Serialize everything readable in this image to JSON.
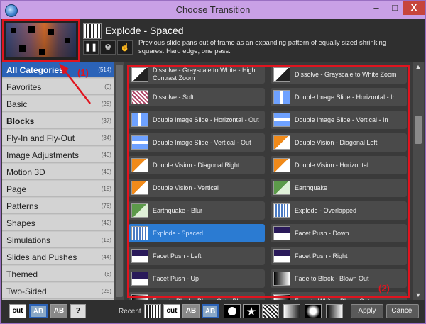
{
  "window": {
    "title": "Choose Transition",
    "minimize": "–",
    "maximize": "□",
    "close": "X"
  },
  "preview": {
    "effect_title": "Explode - Spaced",
    "description": "Previous slide pans out of frame as an expanding pattern of equally sized shrinking squares. Hard edge, one pass.",
    "pause_glyph": "❚❚",
    "gear_glyph": "⚙",
    "hand_glyph": "☝"
  },
  "categories": [
    {
      "label": "All Categories",
      "count": "(514)",
      "selected": true,
      "bold": true
    },
    {
      "label": "Favorites",
      "count": "(0)"
    },
    {
      "label": "Basic",
      "count": "(28)"
    },
    {
      "label": "Blocks",
      "count": "(37)",
      "bold": true
    },
    {
      "label": "Fly-In and Fly-Out",
      "count": "(34)"
    },
    {
      "label": "Image Adjustments",
      "count": "(40)"
    },
    {
      "label": "Motion 3D",
      "count": "(40)"
    },
    {
      "label": "Page",
      "count": "(18)"
    },
    {
      "label": "Patterns",
      "count": "(76)"
    },
    {
      "label": "Shapes",
      "count": "(42)"
    },
    {
      "label": "Simulations",
      "count": "(13)"
    },
    {
      "label": "Slides and Pushes",
      "count": "(44)"
    },
    {
      "label": "Themed",
      "count": "(6)"
    },
    {
      "label": "Two-Sided",
      "count": "(25)"
    }
  ],
  "transitions": [
    {
      "label": "Dissolve - Grayscale to White - High Contrast Zoom",
      "icon": "dissolve-white"
    },
    {
      "label": "Dissolve - Grayscale to White Zoom",
      "icon": "dissolve-white"
    },
    {
      "label": "Dissolve - Soft",
      "icon": "dissolve-soft"
    },
    {
      "label": "Double Image Slide - Horizontal - In",
      "icon": "double-slide-h"
    },
    {
      "label": "Double Image Slide - Horizontal - Out",
      "icon": "double-slide-h"
    },
    {
      "label": "Double Image Slide - Vertical - In",
      "icon": "double-slide-v"
    },
    {
      "label": "Double Image Slide - Vertical - Out",
      "icon": "double-slide-v"
    },
    {
      "label": "Double Vision - Diagonal Left",
      "icon": "double-vision"
    },
    {
      "label": "Double Vision - Diagonal Right",
      "icon": "double-vision"
    },
    {
      "label": "Double Vision - Horizontal",
      "icon": "double-vision"
    },
    {
      "label": "Double Vision - Vertical",
      "icon": "double-vision"
    },
    {
      "label": "Earthquake",
      "icon": "earthquake"
    },
    {
      "label": "Earthquake - Blur",
      "icon": "earthquake"
    },
    {
      "label": "Explode - Overlapped",
      "icon": "explode"
    },
    {
      "label": "Explode - Spaced",
      "icon": "explode",
      "selected": true
    },
    {
      "label": "Facet Push - Down",
      "icon": "facet"
    },
    {
      "label": "Facet Push - Left",
      "icon": "facet"
    },
    {
      "label": "Facet Push - Right",
      "icon": "facet"
    },
    {
      "label": "Facet Push - Up",
      "icon": "facet"
    },
    {
      "label": "Fade to Black - Blown Out",
      "icon": "fade-black"
    },
    {
      "label": "Fade to Black - Blown Out - Blur",
      "icon": "fade-black"
    },
    {
      "label": "Fade to White - Blown Out",
      "icon": "fade-white"
    }
  ],
  "annotations": {
    "label1": "(1)",
    "label2": "(2)"
  },
  "footer": {
    "cut_label": "cut",
    "ab_label": "AB",
    "help_label": "?",
    "recent_label": "Recent",
    "apply_label": "Apply",
    "cancel_label": "Cancel"
  }
}
